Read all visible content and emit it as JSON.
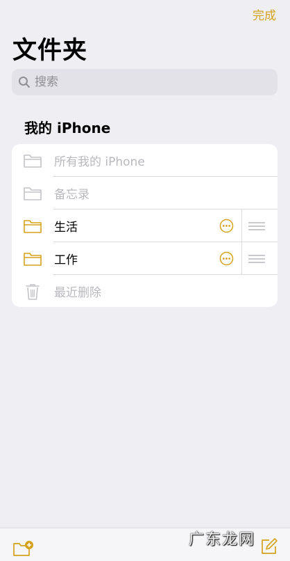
{
  "header": {
    "done_label": "完成",
    "title": "文件夹"
  },
  "search": {
    "placeholder": "搜索"
  },
  "section": {
    "title": "我的 iPhone"
  },
  "folders": [
    {
      "label": "所有我的 iPhone",
      "state": "disabled",
      "icon": "folder-icon"
    },
    {
      "label": "备忘录",
      "state": "disabled",
      "icon": "folder-icon"
    },
    {
      "label": "生活",
      "state": "active",
      "icon": "folder-icon"
    },
    {
      "label": "工作",
      "state": "active",
      "icon": "folder-icon"
    },
    {
      "label": "最近删除",
      "state": "disabled",
      "icon": "trash-icon"
    }
  ],
  "watermark": {
    "text": "广东龙网"
  },
  "colors": {
    "accent": "#d4a21c",
    "disabled": "#b8b8bd",
    "background": "#eeeef3"
  }
}
